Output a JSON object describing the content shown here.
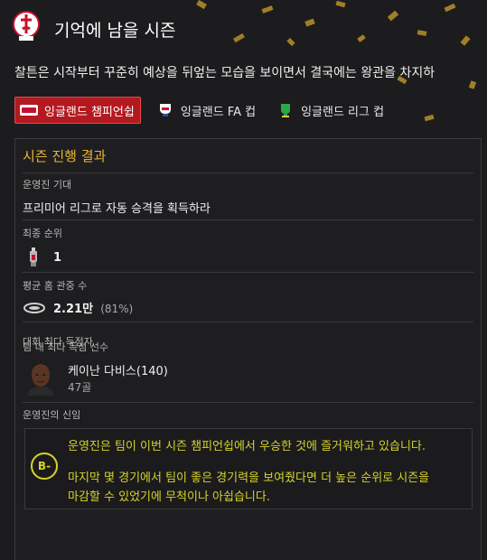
{
  "header": {
    "title": "기억에 남을 시즌",
    "club_crest": "charlton-athletic-crest",
    "intro": "찰튼은 시작부터 꾸준히 예상을 뒤엎는 모습을 보이면서 결국에는 왕관을 차지하"
  },
  "tabs": [
    {
      "label": "잉글랜드 챔피언쉽",
      "icon": "championship-logo-icon",
      "active": true
    },
    {
      "label": "잉글랜드 FA 컵",
      "icon": "fa-cup-logo-icon",
      "active": false
    },
    {
      "label": "잉글랜드 리그 컵",
      "icon": "league-cup-logo-icon",
      "active": false
    }
  ],
  "panel": {
    "title": "시즌 진행 결과",
    "board_expectation_label": "운영진 기대",
    "board_expectation_value": "프리미어 리그로 자동 승격을 획득하라",
    "final_position_label": "최종 순위",
    "final_position_value": "1",
    "avg_attendance_label": "평균 홈 관중 수",
    "avg_attendance_value": "2.21만",
    "avg_attendance_pct": "(81%)",
    "top_scorer_label_overlap_a": "대회 최다 득점자",
    "top_scorer_label_overlap_b": "팀 내 최다 득점 선수",
    "top_scorer_name": "케이난 다비스(140)",
    "top_scorer_goals": "47골",
    "board_confidence_label": "운영진의 신임",
    "grade": "B-",
    "feedback_line1": "운영진은 팀이 이번 시즌 챔피언쉽에서 우승한 것에 즐거워하고 있습니다.",
    "feedback_line2": "마지막 몇 경기에서 팀이 좋은 경기력을 보여줬다면 더 높은 순위로 시즌을",
    "feedback_line3": "마감할 수 있었기에 무척이나 아쉽습니다."
  },
  "colors": {
    "accent": "#e8b533",
    "tab_active": "#b3191f",
    "feedback": "#d6d22a",
    "background": "#1c1c1e"
  }
}
